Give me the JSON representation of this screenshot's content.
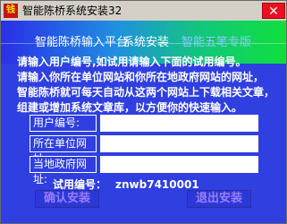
{
  "window": {
    "title": "智能陈桥系统安装32",
    "app_icon_text": "钱"
  },
  "menu": {
    "item1": "智能陈桥输入平台",
    "item2": "系统安装",
    "item3": "智能五笔专版"
  },
  "intro_lines": [
    "请输入用户编号,如试用请输入下面的试用编号。",
    "请输入你所在单位网站和你所在地政府网站的网址，",
    "智能陈桥就可每天自动从这两个网站上下载相关文章，",
    "组建或增加系统文章库，以方便你的快速输入。"
  ],
  "fields": {
    "user_id": {
      "label": "用户编号:",
      "value": ""
    },
    "org_url": {
      "label": "所在单位网址:",
      "value": ""
    },
    "gov_url": {
      "label": "当地政府网址:",
      "value": ""
    }
  },
  "trial": {
    "label": "试用编号：",
    "code": "znwb7410001"
  },
  "buttons": {
    "left": "确认安装",
    "right": "退出安装"
  },
  "colors": {
    "window_bg": "#2f3fe0",
    "gradient_end": "#0fe03b",
    "button_text": "#9a7ef8"
  }
}
